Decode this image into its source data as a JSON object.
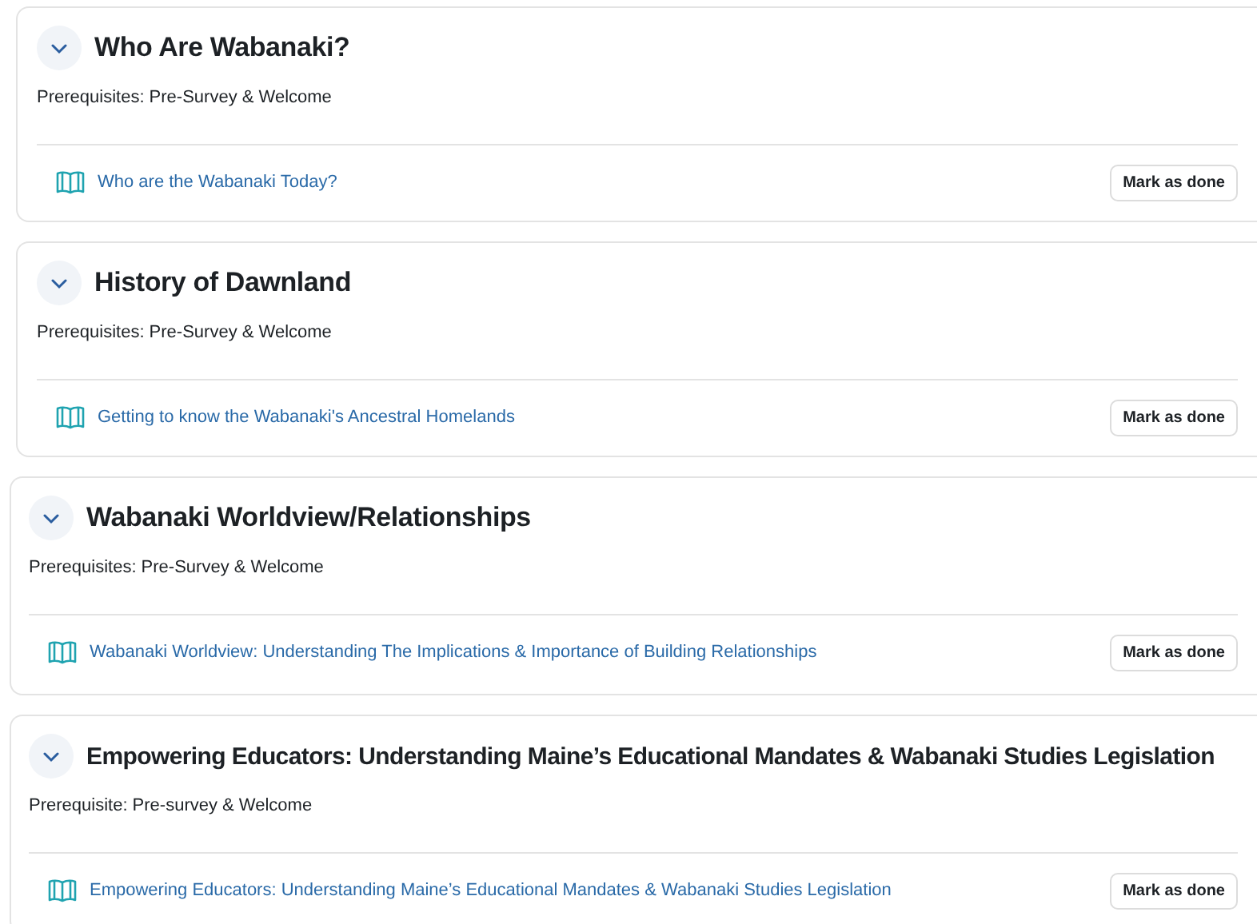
{
  "sections": [
    {
      "title": "Who Are Wabanaki?",
      "expanded": true,
      "prerequisites": "Prerequisites: Pre-Survey & Welcome",
      "activities": [
        {
          "label": "Who are the Wabanaki Today?",
          "button": "Mark as done"
        }
      ]
    },
    {
      "title": "History of Dawnland",
      "expanded": true,
      "prerequisites": "Prerequisites: Pre-Survey & Welcome",
      "activities": [
        {
          "label": "Getting to know the Wabanaki's Ancestral Homelands",
          "button": "Mark as done"
        }
      ]
    },
    {
      "title": "Wabanaki Worldview/Relationships",
      "expanded": true,
      "prerequisites": "Prerequisites: Pre-Survey & Welcome",
      "activities": [
        {
          "label": "Wabanaki Worldview: Understanding The Implications & Importance of Building Relationships",
          "button": "Mark as done"
        }
      ]
    },
    {
      "title": "Empowering Educators: Understanding Maine’s Educational Mandates & Wabanaki Studies Legislation",
      "expanded": true,
      "prerequisites": "Prerequisite: Pre-survey & Welcome",
      "activities": [
        {
          "label": "Empowering Educators: Understanding Maine’s Educational Mandates & Wabanaki Studies Legislation",
          "button": "Mark as done"
        }
      ]
    }
  ]
}
